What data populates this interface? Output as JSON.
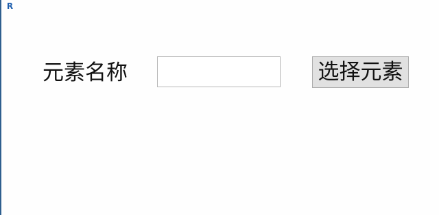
{
  "app": {
    "icon": "revit-r-icon",
    "icon_letter": "R"
  },
  "form": {
    "element_name_label": "元素名称",
    "element_name_value": "",
    "select_button_label": "选择元素"
  },
  "colors": {
    "background": "#fefefe",
    "button_background": "#e1e1e1",
    "icon_blue": "#1f5fae"
  }
}
